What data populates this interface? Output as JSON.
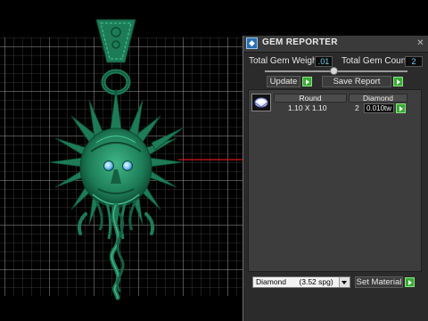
{
  "app": {
    "panel_title": "GEM REPORTER",
    "icons": {
      "title": "gem-reporter-icon",
      "close": "close-icon",
      "thumb": "round-diamond-icon",
      "go": "play-arrow-icon"
    }
  },
  "stats": {
    "total_gem_weight_label": "Total Gem Weight",
    "total_gem_weight_value": ".01",
    "total_gem_count_label": "Total Gem Count",
    "total_gem_count_value": "2"
  },
  "buttons": {
    "update": "Update",
    "save_report": "Save Report",
    "set_material": "Set Material"
  },
  "gem_table": {
    "columns": [
      "Round",
      "Diamond"
    ],
    "rows": [
      {
        "size": "1.10 X 1.10",
        "count": "2",
        "weight": "0.010tw"
      }
    ]
  },
  "material": {
    "selected": "Diamond",
    "density": "(3.52 spg)"
  },
  "colors": {
    "model": "#1f8a63",
    "model_dark": "#0d4a33",
    "model_light": "#4cc79a",
    "grid": "#8a8a8a",
    "axis_red": "#d01818",
    "gem_blue": "#7ec8ff"
  }
}
